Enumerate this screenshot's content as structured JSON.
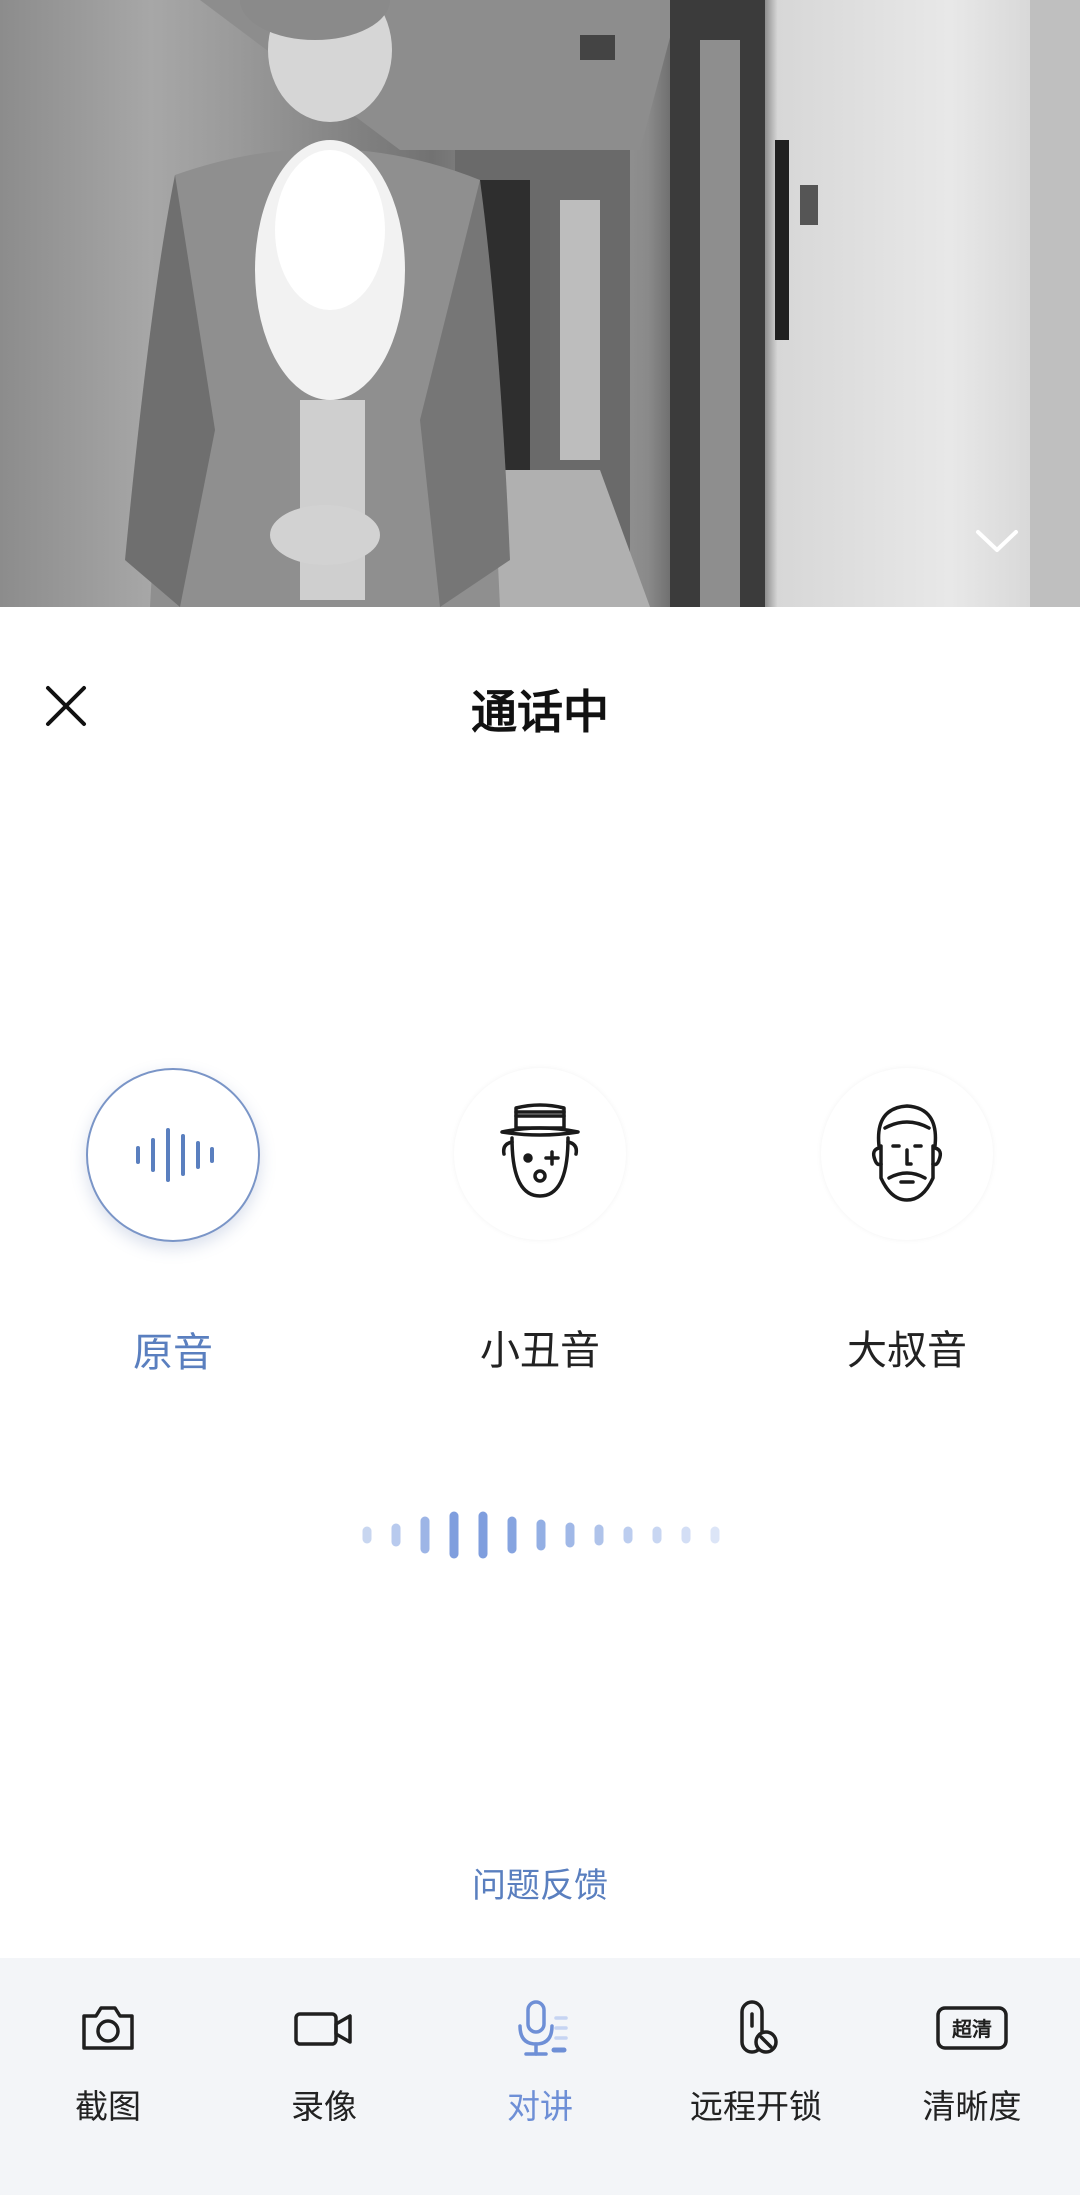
{
  "header": {
    "title": "通话中"
  },
  "voice_changer": {
    "options": [
      {
        "label": "原音",
        "icon": "waveform-icon",
        "selected": true
      },
      {
        "label": "小丑音",
        "icon": "clown-face-icon",
        "selected": false
      },
      {
        "label": "大叔音",
        "icon": "bearded-man-face-icon",
        "selected": false
      }
    ]
  },
  "feedback_link": "问题反馈",
  "toolbar": {
    "items": [
      {
        "label": "截图",
        "icon": "camera-icon",
        "active": false
      },
      {
        "label": "录像",
        "icon": "video-camera-icon",
        "active": false
      },
      {
        "label": "对讲",
        "icon": "microphone-icon",
        "active": true
      },
      {
        "label": "远程开锁",
        "icon": "remote-unlock-icon",
        "active": false
      },
      {
        "label": "清晰度",
        "icon": "quality-badge-icon",
        "active": false,
        "badge_text": "超清"
      }
    ]
  },
  "colors": {
    "accent": "#5a7fbf",
    "toolbar_active": "#6e8fd6",
    "toolbar_bg": "#f3f5f8",
    "text_primary": "#222222"
  }
}
